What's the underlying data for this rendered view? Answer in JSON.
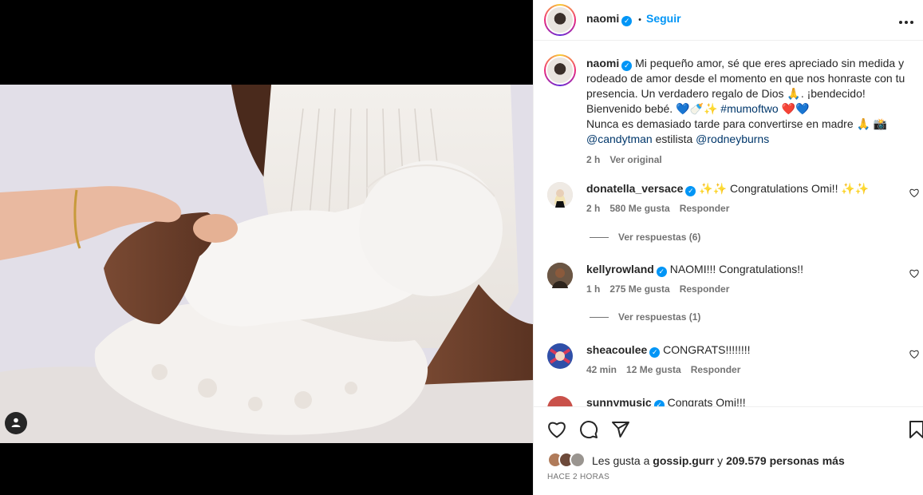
{
  "header": {
    "username": "naomi",
    "dot": "•",
    "follow_label": "Seguir",
    "more_icon": "more-horizontal-icon"
  },
  "caption": {
    "username": "naomi",
    "text_1": "Mi pequeño amor, sé que eres apreciado sin medida y rodeado de amor desde el momento en que nos honraste con tu presencia. Un verdadero regalo de Dios ",
    "emoji_pray": "🙏",
    "text_2": ". ¡bendecido!",
    "text_3": "Bienvenido bebé. ",
    "emoji_row": "💙🍼✨",
    "hashtag": "#mumoftwo",
    "emoji_hearts": "❤️💙",
    "text_4": "Nunca es demasiado tarde para convertirse en madre ",
    "emoji_end": "🙏 📸",
    "mention_1": "@candytman",
    "mid_word": " estilista ",
    "mention_2": "@rodneyburns",
    "time": "2 h",
    "see_original": "Ver original"
  },
  "comments": [
    {
      "username": "donatella_versace",
      "sparkles_a": "✨✨",
      "text": " Congratulations Omi!! ",
      "sparkles_b": "✨✨",
      "time": "2 h",
      "likes": "580 Me gusta",
      "reply": "Responder",
      "replies": "Ver respuestas (6)",
      "avatar_color": "#d9d4cc"
    },
    {
      "username": "kellyrowland",
      "text": "NAOMI!!! Congratulations!!",
      "time": "1 h",
      "likes": "275 Me gusta",
      "reply": "Responder",
      "replies": "Ver respuestas (1)",
      "avatar_color": "#5b4634"
    },
    {
      "username": "sheacoulee",
      "text": "CONGRATS!!!!!!!!",
      "time": "42 min",
      "likes": "12 Me gusta",
      "reply": "Responder",
      "avatar_color": "#3553a8"
    },
    {
      "username": "sunnymusic",
      "text": "Congrats Omi!!!",
      "avatar_color": "#c9514a"
    }
  ],
  "actions": {
    "like_icon": "heart-icon",
    "comment_icon": "comment-icon",
    "share_icon": "send-icon",
    "save_icon": "bookmark-icon",
    "likes_prefix": "Les gusta a ",
    "likes_user": "gossip.gurr",
    "likes_mid": " y ",
    "likes_count": "209.579 personas más",
    "posted_ago": "HACE 2 HORAS"
  },
  "media": {
    "tag_icon": "user-tag-icon"
  },
  "colors": {
    "accent": "#0095f6",
    "hashtag": "#00376b",
    "muted": "#737373"
  }
}
